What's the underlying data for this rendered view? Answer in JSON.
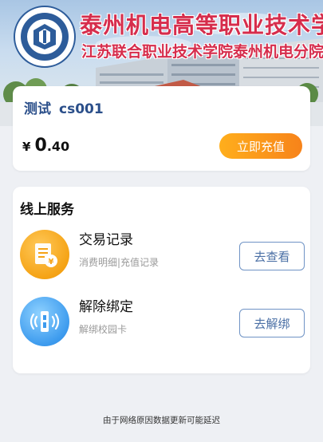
{
  "banner": {
    "school_name": "泰州机电高等职业技术学校",
    "school_sub": "江苏联合职业技术学院泰州机电分院",
    "logo_icon": "school-logo"
  },
  "account": {
    "user_label": "测试",
    "user_id": "cs001",
    "currency": "¥",
    "balance_int": "0",
    "balance_dec": ".40",
    "recharge_label": "立即充值"
  },
  "services": {
    "title": "线上服务",
    "items": [
      {
        "title": "交易记录",
        "desc": "消费明细|充值记录",
        "button": "去查看",
        "icon": "receipt-icon",
        "color": "#f5a315"
      },
      {
        "title": "解除绑定",
        "desc": "解绑校园卡",
        "button": "去解绑",
        "icon": "card-unbind-icon",
        "color": "#3d9bee"
      }
    ]
  },
  "footer": {
    "note": "由于网络原因数据更新可能延迟"
  },
  "colors": {
    "accent_orange": "#f7831a",
    "title_blue": "#2b4f8a",
    "banner_red": "#d62d4c"
  }
}
